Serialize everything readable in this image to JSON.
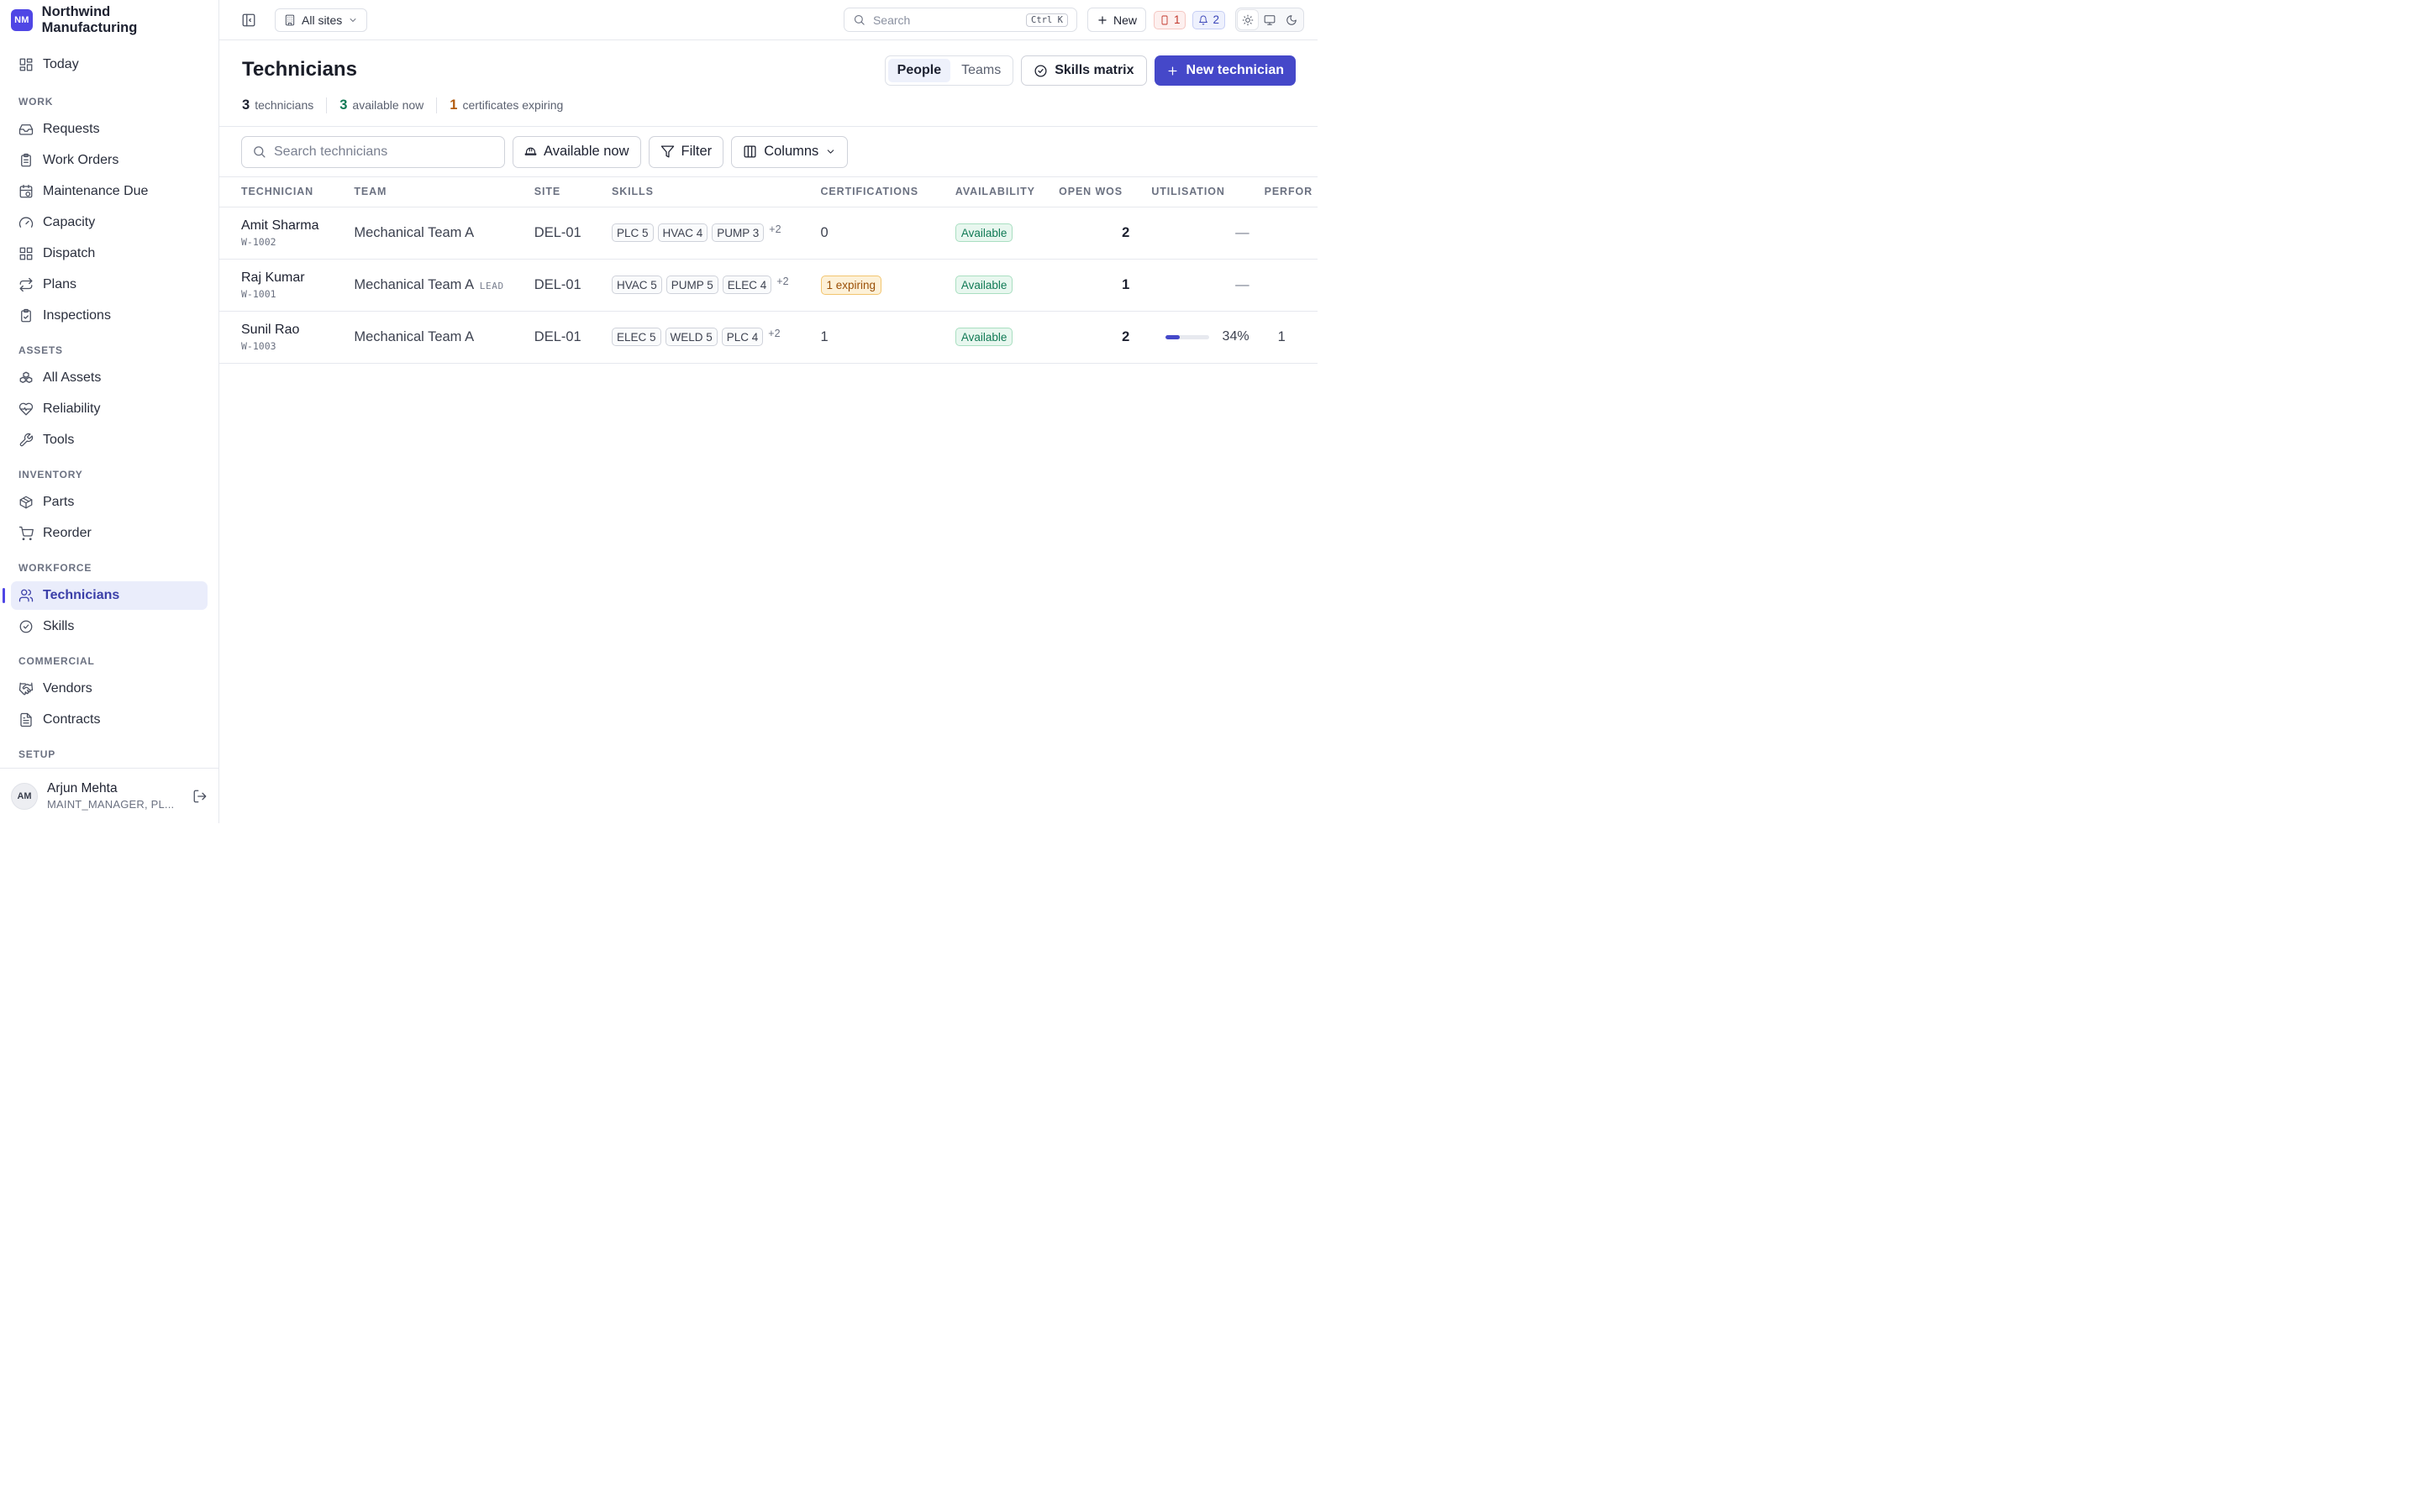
{
  "brand": {
    "initials": "NM",
    "name": "Northwind Manufacturing"
  },
  "sidebar": {
    "today": "Today",
    "sections": {
      "work": "WORK",
      "assets": "ASSETS",
      "inventory": "INVENTORY",
      "workforce": "WORKFORCE",
      "commercial": "COMMERCIAL",
      "setup": "SETUP"
    },
    "items": {
      "requests": "Requests",
      "work_orders": "Work Orders",
      "maintenance_due": "Maintenance Due",
      "capacity": "Capacity",
      "dispatch": "Dispatch",
      "plans": "Plans",
      "inspections": "Inspections",
      "all_assets": "All Assets",
      "reliability": "Reliability",
      "tools": "Tools",
      "parts": "Parts",
      "reorder": "Reorder",
      "technicians": "Technicians",
      "skills": "Skills",
      "vendors": "Vendors",
      "contracts": "Contracts"
    },
    "active": "technicians"
  },
  "user": {
    "initials": "AM",
    "name": "Arjun Mehta",
    "role": "MAINT_MANAGER, PL..."
  },
  "topbar": {
    "site_select": "All sites",
    "search_placeholder": "Search",
    "search_shortcut": "Ctrl K",
    "new_label": "New",
    "alerts_count": "1",
    "notifications_count": "2",
    "theme_options": [
      "light",
      "system",
      "dark"
    ],
    "theme_selected": "light"
  },
  "page": {
    "title": "Technicians",
    "stats": [
      {
        "value": "3",
        "label": "technicians"
      },
      {
        "value": "3",
        "label": "available now"
      },
      {
        "value": "1",
        "label": "certificates expiring"
      }
    ],
    "view_toggle": {
      "people": "People",
      "teams": "Teams",
      "selected": "People"
    },
    "skills_matrix": "Skills matrix",
    "new_technician": "New technician"
  },
  "toolbar": {
    "search_placeholder": "Search technicians",
    "available_now": "Available now",
    "filter": "Filter",
    "columns": "Columns"
  },
  "table": {
    "headers": [
      "TECHNICIAN",
      "TEAM",
      "SITE",
      "SKILLS",
      "CERTIFICATIONS",
      "AVAILABILITY",
      "OPEN WOS",
      "UTILISATION",
      "PERFOR"
    ],
    "rows": [
      {
        "name": "Amit Sharma",
        "id": "W-1002",
        "team": "Mechanical Team A",
        "lead": "",
        "site": "DEL-01",
        "skills": [
          "PLC 5",
          "HVAC 4",
          "PUMP 3"
        ],
        "skills_more": "+2",
        "certifications": "0",
        "cert_expiring": "",
        "availability": "Available",
        "open_wos": "2",
        "utilisation": "—",
        "utilisation_pct": null,
        "performance": ""
      },
      {
        "name": "Raj Kumar",
        "id": "W-1001",
        "team": "Mechanical Team A",
        "lead": "LEAD",
        "site": "DEL-01",
        "skills": [
          "HVAC 5",
          "PUMP 5",
          "ELEC 4"
        ],
        "skills_more": "+2",
        "certifications": "",
        "cert_expiring": "1 expiring",
        "availability": "Available",
        "open_wos": "1",
        "utilisation": "—",
        "utilisation_pct": null,
        "performance": ""
      },
      {
        "name": "Sunil Rao",
        "id": "W-1003",
        "team": "Mechanical Team A",
        "lead": "",
        "site": "DEL-01",
        "skills": [
          "ELEC 5",
          "WELD 5",
          "PLC 4"
        ],
        "skills_more": "+2",
        "certifications": "1",
        "cert_expiring": "",
        "availability": "Available",
        "open_wos": "2",
        "utilisation": "34%",
        "utilisation_pct": 34,
        "performance": "1"
      }
    ]
  },
  "colors": {
    "accent": "#4548c9",
    "available": "#117a55",
    "expiring": "#9a4f06"
  }
}
